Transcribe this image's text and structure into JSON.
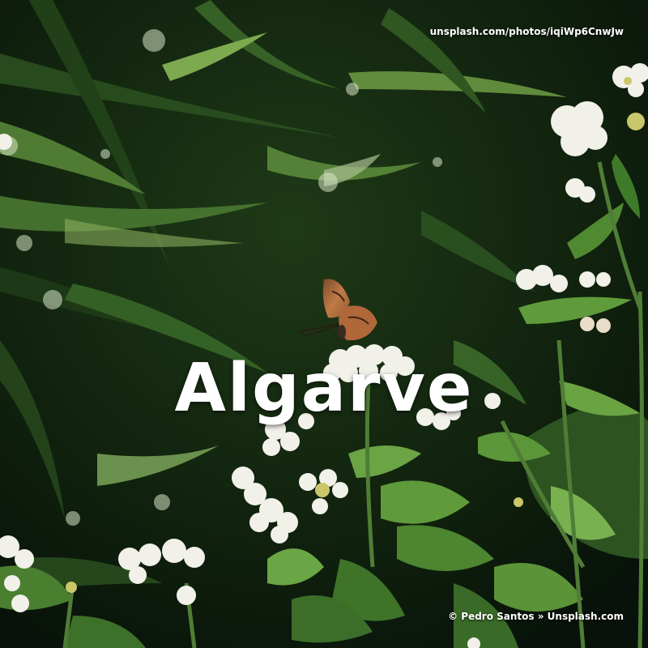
{
  "photo": {
    "subject": "butterfly-on-white-lantana-flowers",
    "colors": {
      "background_dark": "#0d1a0c",
      "foliage_mid": "#2f5a22",
      "foliage_light": "#7fb04a",
      "flower_white": "#f1f1ea",
      "flower_center": "#c9c76a",
      "butterfly_orange": "#b0673a"
    }
  },
  "overlay": {
    "title": "Algarve",
    "source_url": "unsplash.com/photos/iqiWp6CnwJw",
    "credit": "© Pedro Santos » Unsplash.com"
  }
}
